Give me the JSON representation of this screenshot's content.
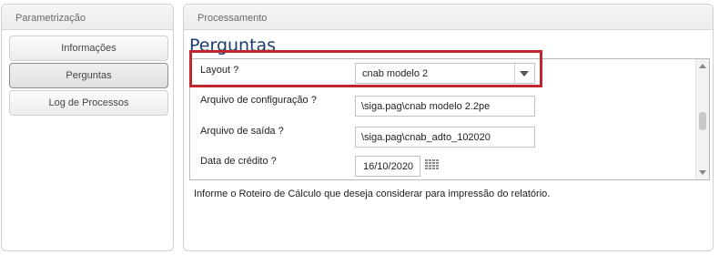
{
  "left_panel": {
    "title": "Parametrização",
    "buttons": [
      {
        "label": "Informações"
      },
      {
        "label": "Perguntas"
      },
      {
        "label": "Log de Processos"
      }
    ]
  },
  "right_panel": {
    "title": "Processamento",
    "page_title": "Perguntas",
    "questions": [
      {
        "label": "Layout ?",
        "value": "cnab modelo 2"
      },
      {
        "label": "Arquivo de configuração ?",
        "value": "\\siga.pag\\cnab modelo 2.2pe"
      },
      {
        "label": "Arquivo de saída ?",
        "value": "\\siga.pag\\cnab_adto_102020"
      },
      {
        "label": "Data de crédito ?",
        "value": "16/10/2020"
      }
    ],
    "info": "Informe o Roteiro de Cálculo que deseja considerar para impressão do relatório."
  },
  "colors": {
    "highlight": "#c0262d",
    "title": "#1a3d6d"
  },
  "icons": {
    "select_arrow": "chevron-down-icon",
    "calendar": "calendar-icon",
    "scroll_up": "arrow-up-icon",
    "scroll_down": "arrow-down-icon"
  }
}
